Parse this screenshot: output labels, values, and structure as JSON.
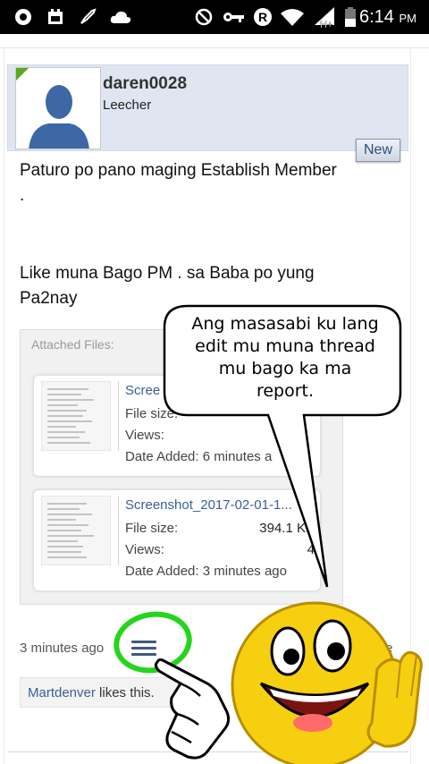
{
  "status_bar": {
    "time": "6:14",
    "ampm": "PM",
    "icons": [
      "record-icon",
      "calendar-icon",
      "rocket-icon",
      "cloud-icon",
      "do-not-disturb-icon",
      "key-icon",
      "registered-icon",
      "wifi-icon",
      "signal-icon",
      "battery-icon"
    ]
  },
  "post": {
    "username": "daren0028",
    "user_title": "Leecher",
    "new_badge": "New",
    "message_line1": "Paturo po pano maging Establish Member .",
    "message_line2": "Like muna Bago PM . sa Baba po yung Pa2nay",
    "attached_label": "Attached Files:",
    "attachments": [
      {
        "name": "Screenshot_2017-02-01-1...",
        "file_size_label": "File size:",
        "file_size": "",
        "views_label": "Views:",
        "views": "",
        "date_label": "Date Added:",
        "date_added": "6 minutes a"
      },
      {
        "name": "Screenshot_2017-02-01-1...",
        "file_size_label": "File size:",
        "file_size": "394.1 KB",
        "views_label": "Views:",
        "views": "4",
        "date_label": "Date Added:",
        "date_added": "3 minutes ago"
      }
    ],
    "attachment1_visible_name": "Scree",
    "time_ago": "3 minutes ago",
    "like_label": "Like",
    "liker": "Martdenver",
    "likes_suffix": " likes this."
  },
  "overlay": {
    "speech_line1": "Ang masasabi ku lang",
    "speech_line2": "edit mu muna thread",
    "speech_line3": "mu bago ka ma",
    "speech_line4": "report.",
    "highlight_color": "#27d41d",
    "emoji_color": "#f6cf10"
  }
}
